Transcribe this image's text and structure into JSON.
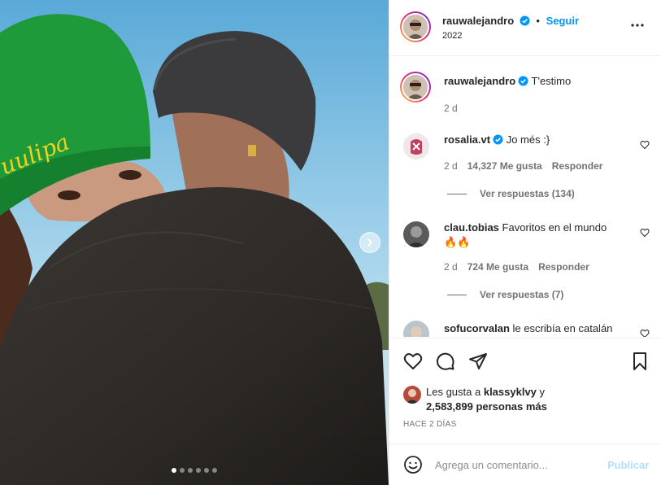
{
  "post": {
    "author": "rauwalejandro",
    "follow_label": "Seguir",
    "separator": "•",
    "location": "2022",
    "more_icon": "more-horizontal-icon",
    "verified_icon": "verified-badge-icon"
  },
  "caption": {
    "author": "rauwalejandro",
    "text": "T'estimo",
    "time": "2 d"
  },
  "comments": [
    {
      "author": "rosalia.vt",
      "verified": true,
      "text": "Jo més :}",
      "time": "2 d",
      "likes": "14,327 Me gusta",
      "reply_label": "Responder",
      "view_replies": "Ver respuestas (134)"
    },
    {
      "author": "clau.tobias",
      "verified": false,
      "text": "Favoritos en el mundo",
      "emoji": "🔥🔥",
      "time": "2 d",
      "likes": "724 Me gusta",
      "reply_label": "Responder",
      "view_replies": "Ver respuestas (7)"
    },
    {
      "author": "sofucorvalan",
      "verified": false,
      "text": "le escribía en catalán"
    }
  ],
  "likes": {
    "prefix": "Les gusta a",
    "user": "klassyklvy",
    "connector": "y",
    "count": "2,583,899 personas más"
  },
  "timestamp": "HACE 2 DÍAS",
  "composer": {
    "placeholder": "Agrega un comentario...",
    "publish_label": "Publicar",
    "emoji_icon": "emoji-smile-icon"
  },
  "carousel": {
    "total": 6,
    "active": 1
  },
  "colors": {
    "accent": "#0095f6",
    "publish_disabled": "#b2dffc",
    "secondary_text": "#737373",
    "beanie_green": "#1f9a3a",
    "beanie_logo_yellow": "#f2d21a"
  }
}
